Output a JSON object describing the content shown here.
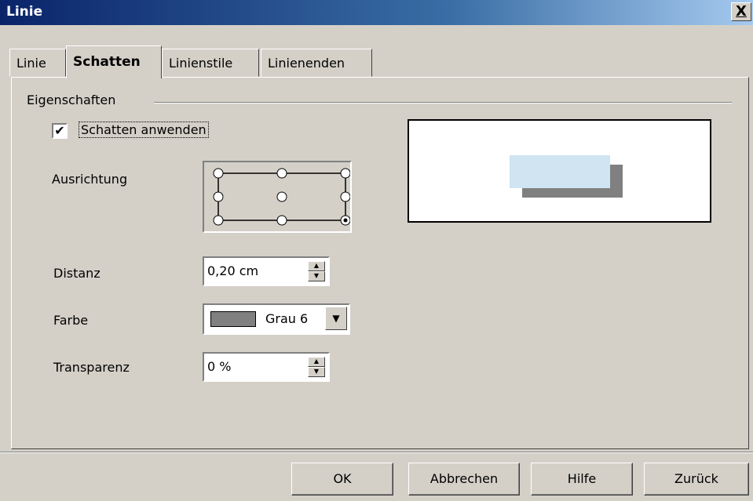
{
  "window": {
    "title": "Linie",
    "close_label": "X"
  },
  "tabs": [
    {
      "label": "Linie"
    },
    {
      "label": "Schatten",
      "active": true
    },
    {
      "label": "Linienstile"
    },
    {
      "label": "Linienenden"
    }
  ],
  "properties": {
    "group_label": "Eigenschaften",
    "apply_shadow": {
      "label": "Schatten anwenden",
      "checked": true,
      "mark": "✔"
    },
    "alignment": {
      "label": "Ausrichtung",
      "selected": "bottom-right"
    },
    "distance": {
      "label": "Distanz",
      "value": "0,20 cm"
    },
    "color": {
      "label": "Farbe",
      "value": "Grau 6",
      "swatch": "#808080"
    },
    "transparency": {
      "label": "Transparenz",
      "value": "0 %"
    }
  },
  "buttons": {
    "ok": "OK",
    "cancel": "Abbrechen",
    "help": "Hilfe",
    "back": "Zurück"
  },
  "colors": {
    "titlebar_start": "#0a246a",
    "preview_object": "#d0e4f2",
    "preview_shadow": "#808080"
  }
}
